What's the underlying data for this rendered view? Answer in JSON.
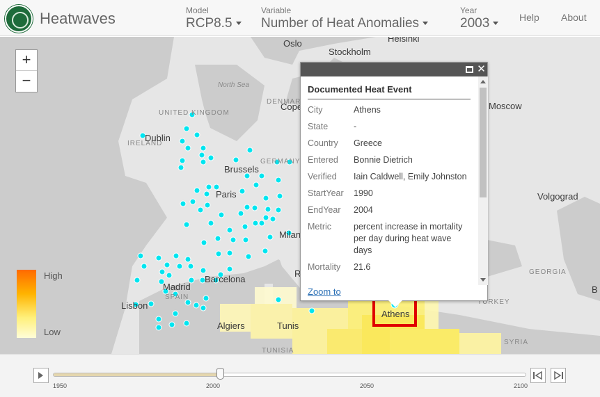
{
  "header": {
    "app_title": "Heatwaves",
    "model": {
      "label": "Model",
      "value": "RCP8.5"
    },
    "variable": {
      "label": "Variable",
      "value": "Number of Heat Anomalies"
    },
    "year": {
      "label": "Year",
      "value": "2003"
    },
    "help": "Help",
    "about": "About"
  },
  "map": {
    "labels": {
      "oslo": "Oslo",
      "stockholm": "Stockholm",
      "helsinki": "Helsinki",
      "moscow": "Moscow",
      "north_sea": "North Sea",
      "united_kingdom": "UNITED KINGDOM",
      "ireland": "IRELAND",
      "dublin": "Dublin",
      "denmark": "DENMARK",
      "copenhagen": "Cope",
      "germany": "GERMANY",
      "brussels": "Brussels",
      "paris": "Paris",
      "milan": "Milan",
      "r": "R",
      "volgograd": "Volgograd",
      "georgia": "GEORGIA",
      "turkey": "TURKEY",
      "barcelona": "Barcelona",
      "madrid": "Madrid",
      "spain": "SPAIN",
      "lisbon": "Lisbon",
      "algiers": "Algiers",
      "tunis": "Tunis",
      "athens": "Athens",
      "tunisia": "TUNISIA",
      "syria": "SYRIA",
      "b": "B"
    },
    "legend": {
      "high": "High",
      "low": "Low"
    },
    "colors": {
      "point": "#00e5f0",
      "anomaly_high": "#ff6a00",
      "anomaly_low": "#fffdd8",
      "highlight": "#e00000"
    }
  },
  "popup": {
    "title": "Documented Heat Event",
    "fields": [
      {
        "key": "City",
        "value": "Athens"
      },
      {
        "key": "State",
        "value": "-"
      },
      {
        "key": "Country",
        "value": "Greece"
      },
      {
        "key": "Entered",
        "value": "Bonnie Dietrich"
      },
      {
        "key": "Verified",
        "value": "Iain Caldwell, Emily Johnston"
      },
      {
        "key": "StartYear",
        "value": "1990"
      },
      {
        "key": "EndYear",
        "value": "2004"
      },
      {
        "key": "Metric",
        "value": "percent increase in mortality per day during heat wave days"
      },
      {
        "key": "Mortality",
        "value": "21.6"
      }
    ],
    "zoom_to": "Zoom to"
  },
  "timeline": {
    "ticks": [
      "1950",
      "2000",
      "2050",
      "2100"
    ],
    "current_year": 2003,
    "range": [
      1950,
      2100
    ]
  }
}
